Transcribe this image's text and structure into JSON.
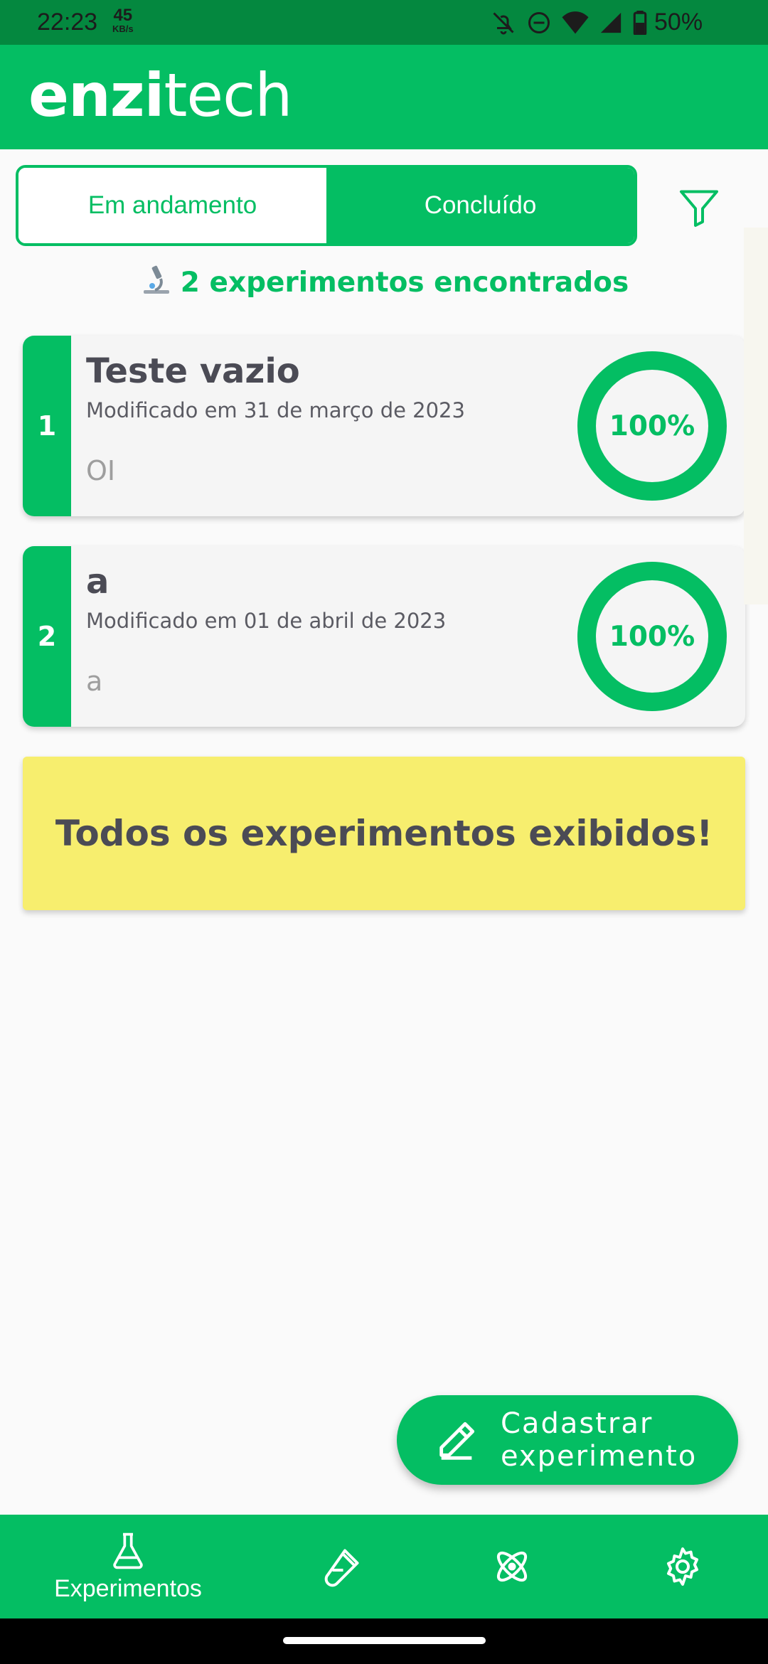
{
  "status_bar": {
    "time": "22:23",
    "net_speed": "45",
    "net_unit": "KB/s",
    "battery": "50%"
  },
  "app": {
    "logo_bold": "enzi",
    "logo_regular": "tech",
    "brand_color": "#04be63"
  },
  "tabs": {
    "in_progress": "Em andamento",
    "completed": "Concluído",
    "active": "Concluído"
  },
  "summary": {
    "count_text": "2 experimentos encontrados"
  },
  "experiments": [
    {
      "index": "1",
      "title": "Teste vazio",
      "modified": "Modificado em 31 de março de 2023",
      "description": "OI",
      "progress_label": "100%",
      "progress": 1.0
    },
    {
      "index": "2",
      "title": "a",
      "modified": "Modificado em 01 de abril de 2023",
      "description": "a",
      "progress_label": "100%",
      "progress": 1.0
    }
  ],
  "banner": {
    "text": "Todos os experimentos exibidos!"
  },
  "fab": {
    "line1": "Cadastrar",
    "line2": "experimento"
  },
  "bottom_nav": {
    "items": [
      {
        "label": "Experimentos",
        "icon": "flask-icon",
        "active": true
      },
      {
        "label": "",
        "icon": "test-tube-icon",
        "active": false
      },
      {
        "label": "",
        "icon": "atom-icon",
        "active": false
      },
      {
        "label": "",
        "icon": "gear-icon",
        "active": false
      }
    ]
  }
}
